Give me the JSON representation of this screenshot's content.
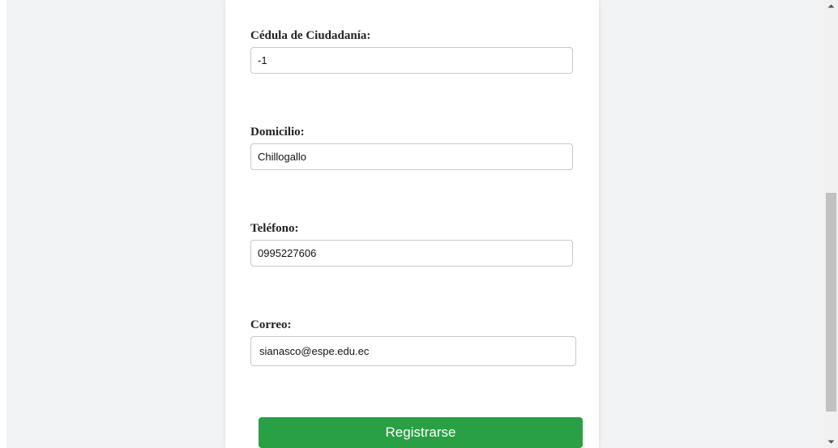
{
  "form": {
    "cedula": {
      "label": "Cédula de Ciudadanía:",
      "value": "-1"
    },
    "domicilio": {
      "label": "Domicilio:",
      "value": "Chillogallo"
    },
    "telefono": {
      "label": "Teléfono:",
      "value": "0995227606"
    },
    "correo": {
      "label": "Correo:",
      "value": "sianasco@espe.edu.ec"
    },
    "submit_label": "Registrarse"
  },
  "colors": {
    "button": "#28a043",
    "page_background": "#f2f3f5"
  },
  "icons": {
    "scroll_up": "scroll-up-arrow-icon",
    "scroll_down": "scroll-down-arrow-icon"
  }
}
